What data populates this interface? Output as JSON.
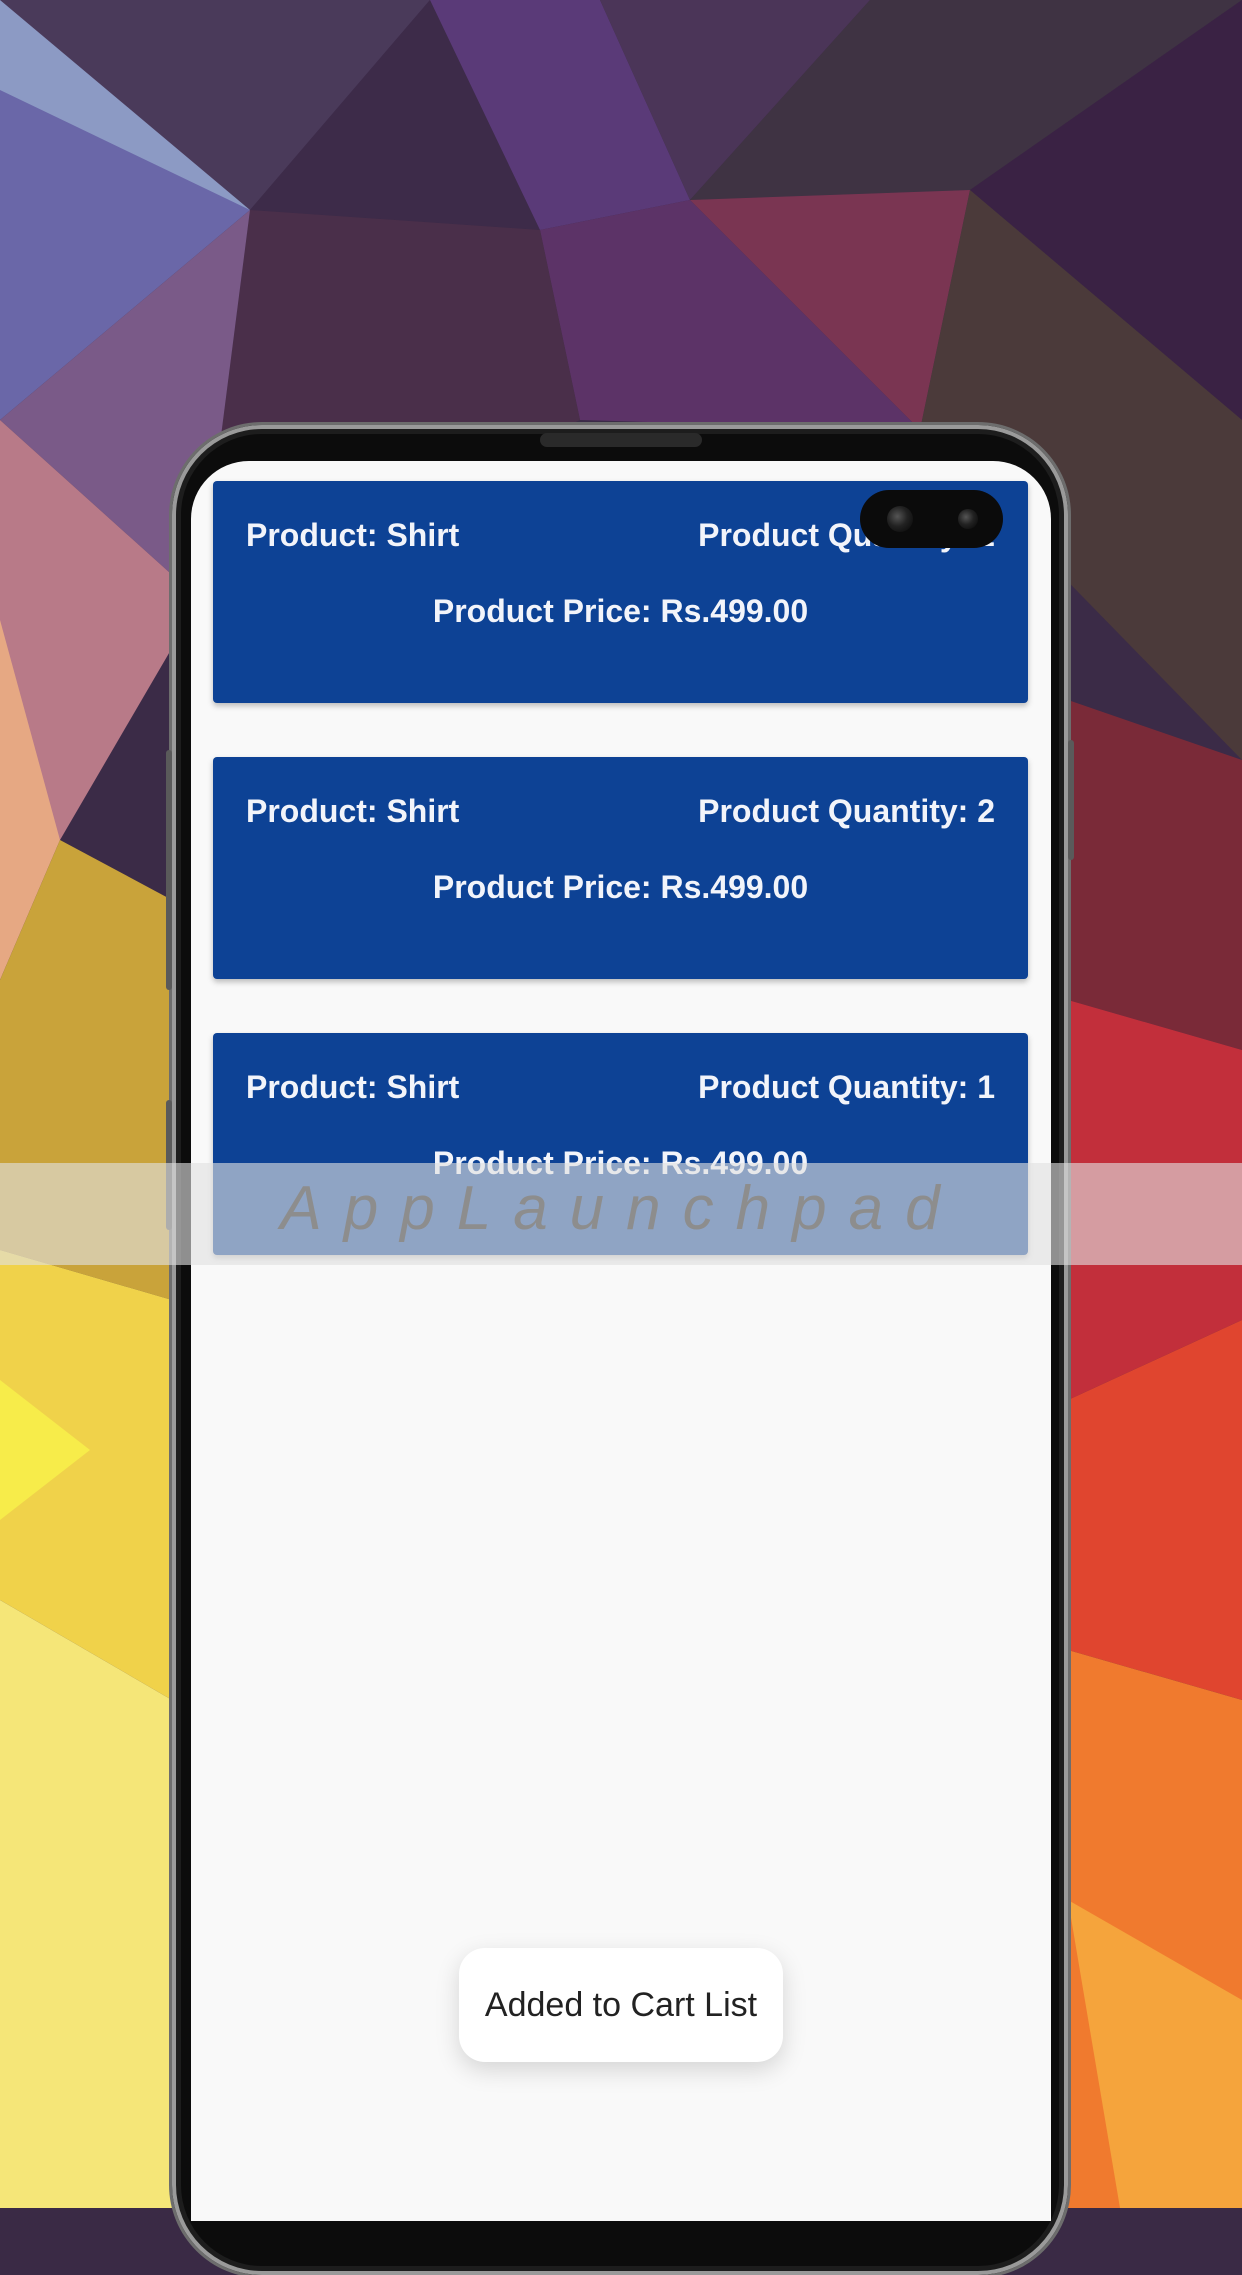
{
  "watermark": "AppLaunchpad",
  "cart_items": [
    {
      "name": "Product: Shirt",
      "quantity": "Product Quantity: 2",
      "price": "Product Price: Rs.499.00"
    },
    {
      "name": "Product: Shirt",
      "quantity": "Product Quantity: 2",
      "price": "Product Price: Rs.499.00"
    },
    {
      "name": "Product: Shirt",
      "quantity": "Product Quantity: 1",
      "price": "Product Price: Rs.499.00"
    }
  ],
  "toast": "Added to Cart List",
  "colors": {
    "card": "#0d4295",
    "card_text": "#f2f4fa",
    "screen": "#f9f9f9"
  }
}
